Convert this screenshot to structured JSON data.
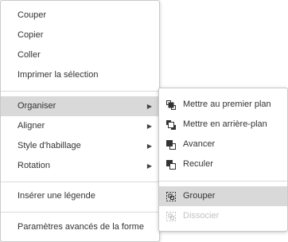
{
  "main_menu": {
    "items": [
      {
        "label": "Couper"
      },
      {
        "label": "Copier"
      },
      {
        "label": "Coller"
      },
      {
        "label": "Imprimer la sélection"
      },
      {
        "label": "Organiser"
      },
      {
        "label": "Aligner"
      },
      {
        "label": "Style d'habillage"
      },
      {
        "label": "Rotation"
      },
      {
        "label": "Insérer une légende"
      },
      {
        "label": "Paramètres avancés de la forme"
      }
    ]
  },
  "submenu": {
    "items": [
      {
        "label": "Mettre au premier plan",
        "icon": "bring-to-front-icon"
      },
      {
        "label": "Mettre en arrière-plan",
        "icon": "send-to-back-icon"
      },
      {
        "label": "Avancer",
        "icon": "bring-forward-icon"
      },
      {
        "label": "Reculer",
        "icon": "send-backward-icon"
      },
      {
        "label": "Grouper",
        "icon": "group-icon"
      },
      {
        "label": "Dissocier",
        "icon": "ungroup-icon"
      }
    ]
  },
  "colors": {
    "highlight": "#d9d9d9",
    "text": "#333333",
    "disabled_text": "#c2c2c2",
    "border": "#c9c9c9"
  }
}
